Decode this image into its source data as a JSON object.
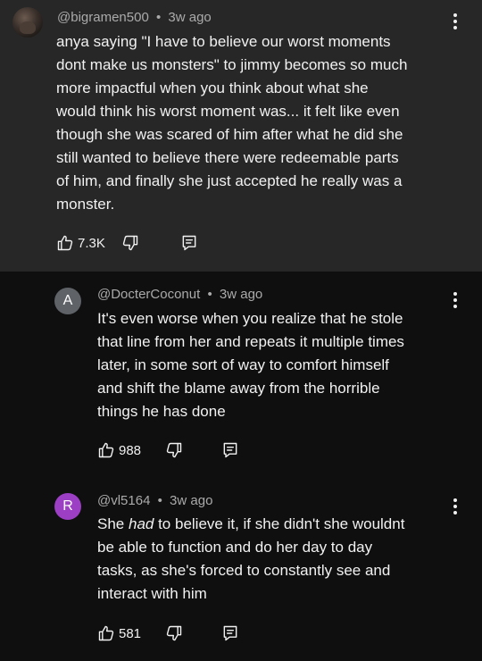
{
  "comments": [
    {
      "handle": "@bigramen500",
      "time": "3w ago",
      "text": "anya saying \"I have to believe our worst moments\ndont make us monsters\" to jimmy becomes so much\nmore impactful when you think about what she\nwould think his worst moment was... it felt like even\nthough she was scared of him after what he did she\nstill wanted to believe there were redeemable parts\nof him, and finally she just accepted he really was a\nmonster.",
      "likes": "7.3K"
    },
    {
      "avatar_letter": "A",
      "avatar_color": "#5f6368",
      "handle": "@DocterCoconut",
      "time": "3w ago",
      "text": "It's even worse when you realize that he stole\nthat line from her and repeats it multiple times\nlater, in some sort of way to comfort himself\nand shift the blame away from the horrible\nthings he has done",
      "likes": "988"
    },
    {
      "avatar_letter": "R",
      "avatar_color": "#9c3fc4",
      "handle": "@vl5164",
      "time": "3w ago",
      "text_before": "She ",
      "text_emphasis": "had",
      "text_after": " to believe it, if she didn't she wouldnt\nbe able to function and do her day to day\ntasks, as she's forced to constantly see and\ninteract with him",
      "likes": "581"
    }
  ],
  "separator": "•",
  "icons": {
    "like": "thumbs-up-icon",
    "dislike": "thumbs-down-icon",
    "reply": "reply-icon",
    "more": "more-vert-icon"
  }
}
